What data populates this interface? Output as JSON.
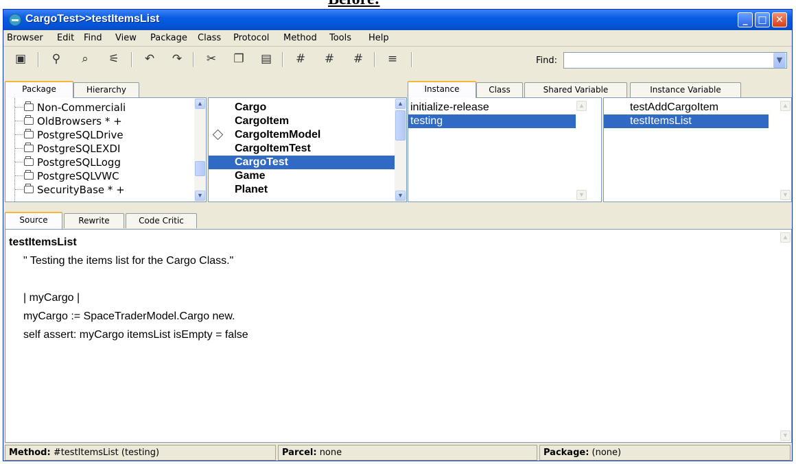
{
  "caption": "Before:",
  "window": {
    "title": "CargoTest>>testItemsList",
    "controls": {
      "minimize": "_",
      "maximize": "□",
      "close": "✕"
    }
  },
  "menubar": [
    "Browser",
    "Edit",
    "Find",
    "View",
    "Package",
    "Class",
    "Protocol",
    "Method",
    "Tools",
    "Help"
  ],
  "toolbar": {
    "icons": [
      "browser-icon",
      "find-binoculars-icon",
      "find-senders-icon",
      "find-implementors-icon",
      "undo-icon",
      "redo-icon",
      "cut-icon",
      "copy-icon",
      "paste-icon",
      "find-hash-icon",
      "find-hash-senders-icon",
      "find-hash-doc-icon",
      "references-icon"
    ],
    "find_label": "Find:",
    "find_value": ""
  },
  "left_tabs": [
    "Package",
    "Hierarchy"
  ],
  "right_tabs": [
    "Instance",
    "Class",
    "Shared Variable",
    "Instance Variable"
  ],
  "packages": [
    "Non-Commerciali",
    "OldBrowsers * +",
    "PostgreSQLDrive",
    "PostgreSQLEXDI",
    "PostgreSQLLogg",
    "PostgreSQLVWC",
    "SecurityBase * +"
  ],
  "classes": [
    {
      "name": "Cargo",
      "marker": ""
    },
    {
      "name": "CargoItem",
      "marker": ""
    },
    {
      "name": "CargoItemModel",
      "marker": "diamond"
    },
    {
      "name": "CargoItemTest",
      "marker": ""
    },
    {
      "name": "CargoTest",
      "marker": "",
      "selected": true
    },
    {
      "name": "Game",
      "marker": ""
    },
    {
      "name": "Planet",
      "marker": ""
    }
  ],
  "protocols": [
    {
      "name": "initialize-release"
    },
    {
      "name": "testing",
      "selected": true
    }
  ],
  "methods": [
    {
      "name": "testAddCargoItem"
    },
    {
      "name": "testItemsList",
      "selected": true
    }
  ],
  "bottom_tabs": [
    "Source",
    "Rewrite",
    "Code Critic"
  ],
  "source": {
    "selector": "testItemsList",
    "lines": [
      "\" Testing the items list for the Cargo Class.\"",
      "",
      "",
      "| myCargo |",
      "myCargo := SpaceTraderModel.Cargo new.",
      "self assert: myCargo itemsList isEmpty = false"
    ]
  },
  "status": {
    "method_label": "Method:",
    "method_value": "#testItemsList (testing)",
    "parcel_label": "Parcel:",
    "parcel_value": "none",
    "package_label": "Package:",
    "package_value": "(none)"
  },
  "colors": {
    "selection": "#316ac5",
    "titlebar": "#0553d6",
    "window_bg": "#ece9d8",
    "tab_accent": "#f5b43a"
  }
}
